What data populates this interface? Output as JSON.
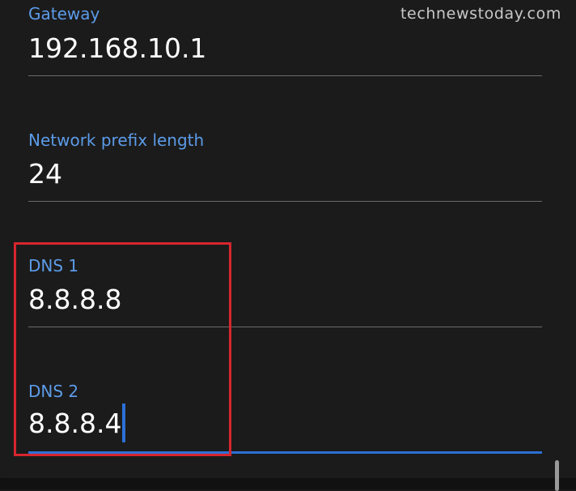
{
  "watermark": "technewstoday.com",
  "fields": {
    "gateway": {
      "label": "Gateway",
      "value": "192.168.10.1"
    },
    "prefix": {
      "label": "Network prefix length",
      "value": "24"
    },
    "dns1": {
      "label": "DNS 1",
      "value": "8.8.8.8"
    },
    "dns2": {
      "label": "DNS 2",
      "value": "8.8.8.4",
      "focused": true
    }
  },
  "colors": {
    "background": "#1b1b1b",
    "label": "#5c9be8",
    "value": "#ffffff",
    "underline": "#6a6a6a",
    "focus_accent": "#2d6fd6",
    "highlight": "#d7262e"
  }
}
